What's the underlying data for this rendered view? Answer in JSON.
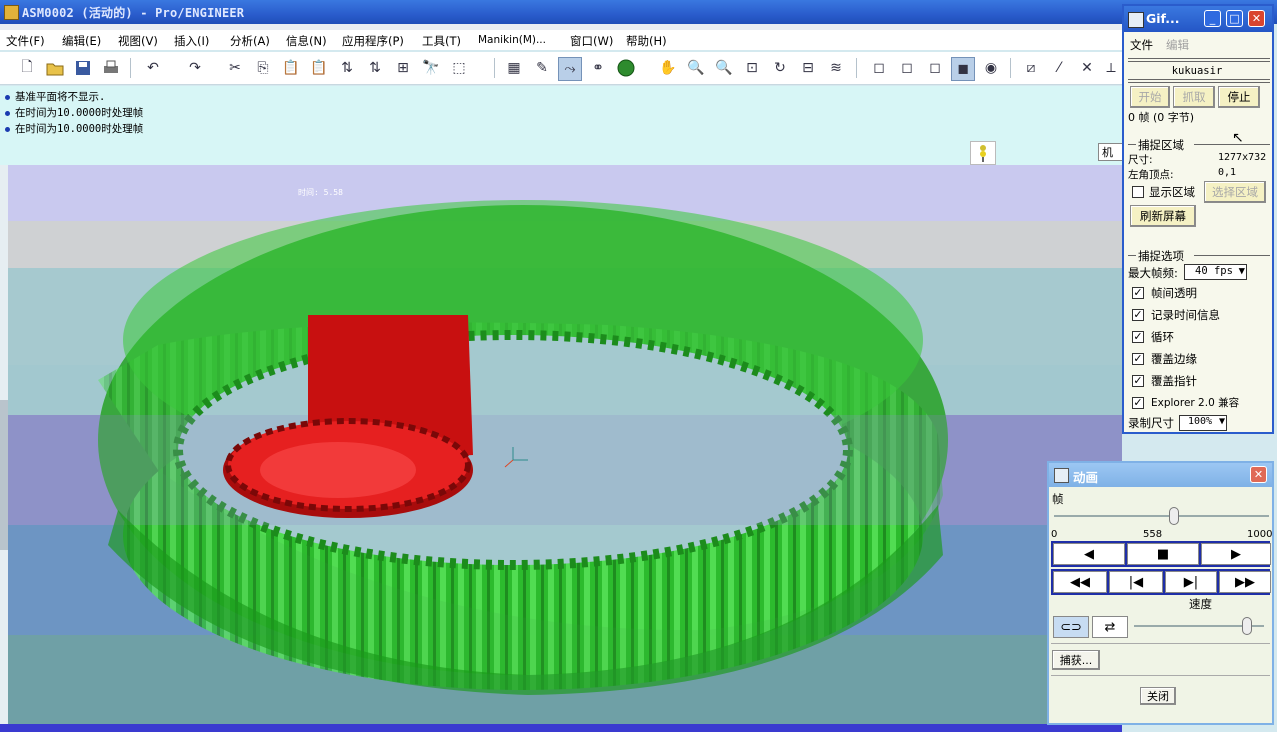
{
  "window": {
    "title": "ASM0002 (活动的) - Pro/ENGINEER"
  },
  "menu": [
    "文件(F)",
    "编辑(E)",
    "视图(V)",
    "插入(I)",
    "分析(A)",
    "信息(N)",
    "应用程序(P)",
    "工具(T)",
    "Manikin(M)...",
    "窗口(W)",
    "帮助(H)"
  ],
  "messages": [
    "基准平面将不显示.",
    "在时间为10.0000时处理帧",
    "在时间为10.0000时处理帧"
  ],
  "viewport": {
    "time_label": "时间: 5.58",
    "mech_label": "机构"
  },
  "gif": {
    "title": "Gif...",
    "menu": {
      "file": "文件",
      "edit": "编辑"
    },
    "name": "kukuasir",
    "buttons": {
      "start": "开始",
      "grab": "抓取",
      "stop": "停止"
    },
    "frames": "0 帧 (0 字节)",
    "capture_area": {
      "heading": "捕捉区域",
      "size_label": "尺寸:",
      "size_value": "1277x732",
      "corner_label": "左角顶点:",
      "corner_value": "0,1",
      "show_area": "显示区域",
      "select_area": "选择区域",
      "refresh": "刷新屏幕"
    },
    "capture_options": {
      "heading": "捕捉选项",
      "max_fps_label": "最大帧频:",
      "max_fps_value": "40 fps",
      "options": [
        "帧间透明",
        "记录时间信息",
        "循环",
        "覆盖边缘",
        "覆盖指针",
        "Explorer 2.0 兼容"
      ],
      "record_size_label": "录制尺寸",
      "record_size_value": "100%"
    }
  },
  "animation": {
    "title": "动画",
    "frame_label": "帧",
    "slider_min": "0",
    "slider_max": "1000",
    "slider_value": "558",
    "frame_fraction": 0.558,
    "speed_label": "速度",
    "capture_button": "捕获...",
    "close_button": "关闭"
  }
}
